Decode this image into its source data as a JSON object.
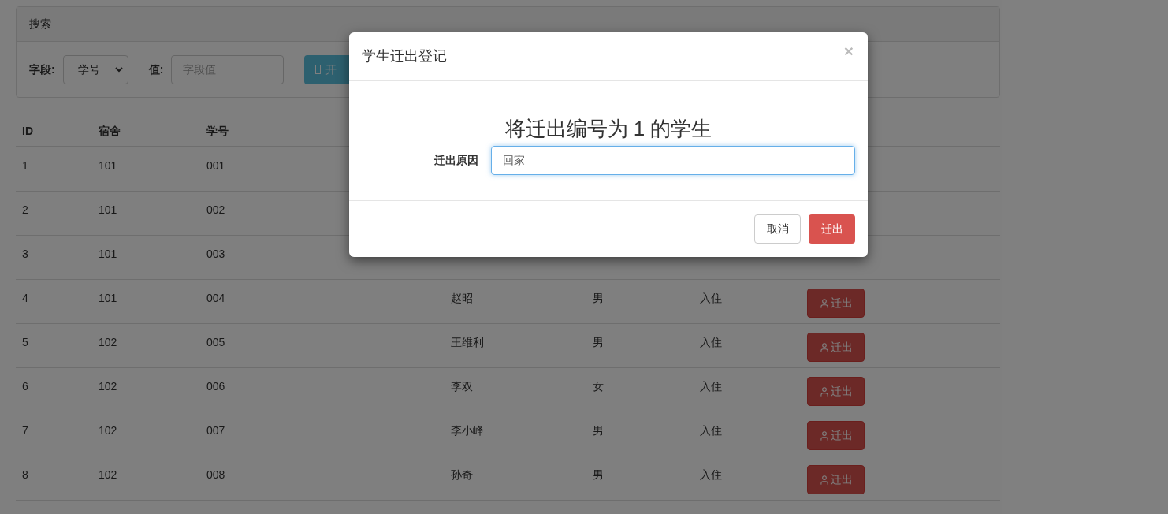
{
  "search_panel": {
    "title": "搜索",
    "field_label": "字段:",
    "field_select": "学号",
    "value_label": "值:",
    "value_placeholder": "字段值",
    "search_button": "开"
  },
  "table": {
    "columns": [
      "ID",
      "宿舍",
      "学号"
    ],
    "rows": [
      {
        "id": "1",
        "dorm": "101",
        "student_no": "001"
      },
      {
        "id": "2",
        "dorm": "101",
        "student_no": "002"
      },
      {
        "id": "3",
        "dorm": "101",
        "student_no": "003"
      },
      {
        "id": "4",
        "dorm": "101",
        "student_no": "004",
        "name": "赵昭",
        "gender": "男",
        "status": "入住",
        "action": "迁出"
      },
      {
        "id": "5",
        "dorm": "102",
        "student_no": "005",
        "name": "王维利",
        "gender": "男",
        "status": "入住",
        "action": "迁出"
      },
      {
        "id": "6",
        "dorm": "102",
        "student_no": "006",
        "name": "李双",
        "gender": "女",
        "status": "入住",
        "action": "迁出"
      },
      {
        "id": "7",
        "dorm": "102",
        "student_no": "007",
        "name": "李小峰",
        "gender": "男",
        "status": "入住",
        "action": "迁出"
      },
      {
        "id": "8",
        "dorm": "102",
        "student_no": "008",
        "name": "孙奇",
        "gender": "男",
        "status": "入住",
        "action": "迁出"
      }
    ]
  },
  "modal": {
    "title": "学生迁出登记",
    "close": "×",
    "heading": "将迁出编号为 1 的学生",
    "reason_label": "迁出原因",
    "reason_value": "回家",
    "cancel_button": "取消",
    "confirm_button": "迁出"
  }
}
